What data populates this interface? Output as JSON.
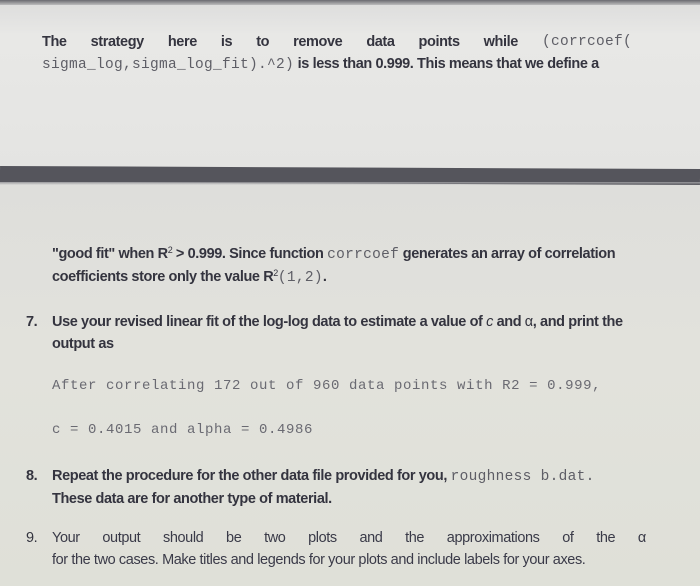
{
  "paragraph_top": {
    "line1_words": [
      "The",
      "strategy",
      "here",
      "is",
      "to",
      "remove",
      "data",
      "points",
      "while"
    ],
    "line1_code": "(corrcoef(",
    "line2_code": "sigma_log,sigma_log_fit).^2)",
    "line2_text": " is less than 0.999. This means that we define a"
  },
  "paragraph_bottom": {
    "line1_prefix": "\"good fit\" when R",
    "sup": "2",
    "line1_mid": " > 0.999. Since function ",
    "line1_code": "corrcoef",
    "line1_suffix": " generates an array of correlation",
    "line2_prefix": "coefficients store only the value R",
    "line2_sup": "2",
    "line2_code": "(1,2)",
    "line2_suffix": "."
  },
  "items": [
    {
      "number": "7.",
      "line1_prefix": "Use your revised linear fit of the log-log data to estimate a value of ",
      "var_c": "c",
      "line1_mid": " and ",
      "var_alpha": "α",
      "line1_suffix": ", and print the",
      "line2": "output as"
    },
    {
      "number": "8.",
      "line1_prefix": "Repeat the procedure for the other data file provided for you, ",
      "line1_code": "roughness b.dat.",
      "line2": "These data are for another type of material."
    },
    {
      "number": "9.",
      "line1_words": [
        "Your",
        "output",
        "should",
        "be",
        "two",
        "plots",
        "and",
        "the",
        "approximations",
        "of",
        "the",
        "α"
      ],
      "line2": "for the two cases. Make titles and legends for your plots and include labels for your axes."
    }
  ],
  "output_example": {
    "line1": "After correlating 172 out of 960 data points with R2 = 0.999,",
    "line2": "c = 0.4015 and alpha = 0.4986"
  }
}
